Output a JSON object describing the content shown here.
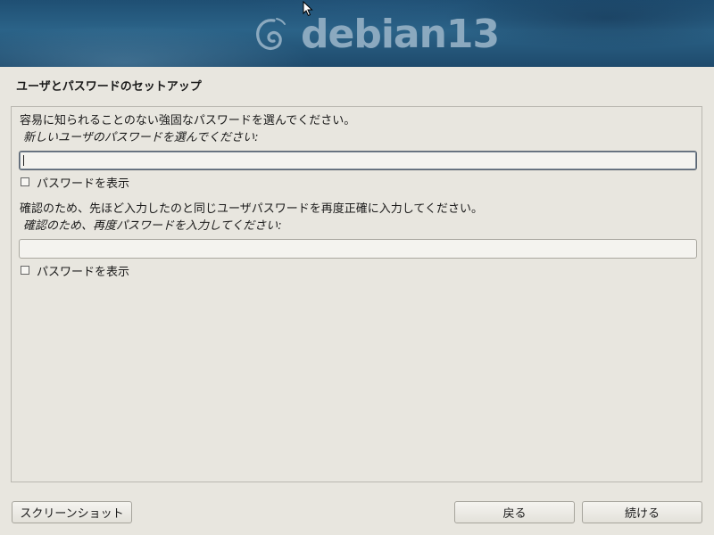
{
  "banner": {
    "logo_icon": "debian-swirl-icon",
    "logo_text": "debian13",
    "colors": {
      "background": "#2b6388",
      "logo": "#8ba9bf"
    }
  },
  "page_title": "ユーザとパスワードのセットアップ",
  "instructions": "容易に知られることのない強固なパスワードを選んでください。",
  "password": {
    "prompt": "新しいユーザのパスワードを選んでください:",
    "value": "",
    "show_password_label": "パスワードを表示"
  },
  "confirm": {
    "instructions": "確認のため、先ほど入力したのと同じユーザパスワードを再度正確に入力してください。",
    "prompt": "確認のため、再度パスワードを入力してください:",
    "value": "",
    "show_password_label": "パスワードを表示"
  },
  "buttons": {
    "screenshot": "スクリーンショット",
    "back": "戻る",
    "continue": "続ける"
  }
}
